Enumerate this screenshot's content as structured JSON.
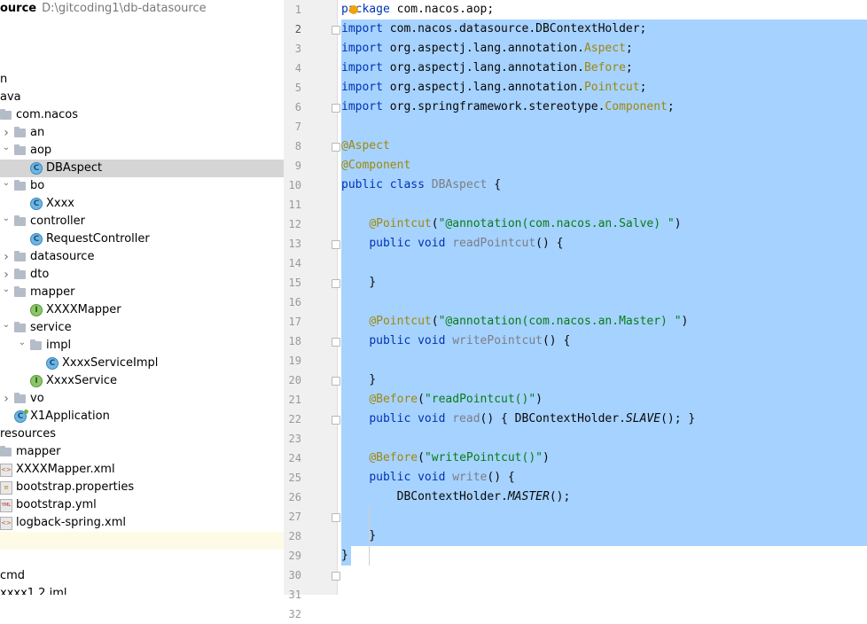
{
  "project": {
    "name": "ource",
    "path": "D:\\gitcoding1\\db-datasource"
  },
  "tree": {
    "items": [
      {
        "label": "n",
        "kind": "none",
        "depth": 0,
        "arrow": ""
      },
      {
        "label": "ava",
        "kind": "none",
        "depth": 0,
        "arrow": ""
      },
      {
        "label": "com.nacos",
        "kind": "folder",
        "depth": 1,
        "arrow": "open"
      },
      {
        "label": "an",
        "kind": "folder",
        "depth": 2,
        "arrow": "closed"
      },
      {
        "label": "aop",
        "kind": "folder",
        "depth": 2,
        "arrow": "open"
      },
      {
        "label": "DBAspect",
        "kind": "class",
        "depth": 3,
        "arrow": "",
        "selected": true
      },
      {
        "label": "bo",
        "kind": "folder",
        "depth": 2,
        "arrow": "open"
      },
      {
        "label": "Xxxx",
        "kind": "class",
        "depth": 3,
        "arrow": ""
      },
      {
        "label": "controller",
        "kind": "folder",
        "depth": 2,
        "arrow": "open"
      },
      {
        "label": "RequestController",
        "kind": "class",
        "depth": 3,
        "arrow": ""
      },
      {
        "label": "datasource",
        "kind": "folder",
        "depth": 2,
        "arrow": "closed"
      },
      {
        "label": "dto",
        "kind": "folder",
        "depth": 2,
        "arrow": "closed"
      },
      {
        "label": "mapper",
        "kind": "folder",
        "depth": 2,
        "arrow": "open"
      },
      {
        "label": "XXXXMapper",
        "kind": "interface",
        "depth": 3,
        "arrow": ""
      },
      {
        "label": "service",
        "kind": "folder",
        "depth": 2,
        "arrow": "open"
      },
      {
        "label": "impl",
        "kind": "folder",
        "depth": 3,
        "arrow": "open"
      },
      {
        "label": "XxxxServiceImpl",
        "kind": "class",
        "depth": 4,
        "arrow": ""
      },
      {
        "label": "XxxxService",
        "kind": "interface",
        "depth": 3,
        "arrow": ""
      },
      {
        "label": "vo",
        "kind": "folder",
        "depth": 2,
        "arrow": "closed"
      },
      {
        "label": "X1Application",
        "kind": "app",
        "depth": 2,
        "arrow": ""
      },
      {
        "label": "resources",
        "kind": "none",
        "depth": 0,
        "arrow": ""
      },
      {
        "label": "mapper",
        "kind": "folder",
        "depth": 0,
        "arrow": ""
      },
      {
        "label": "XXXXMapper.xml",
        "kind": "xml",
        "depth": 1,
        "arrow": ""
      },
      {
        "label": "bootstrap.properties",
        "kind": "props",
        "depth": 0,
        "arrow": ""
      },
      {
        "label": "bootstrap.yml",
        "kind": "yml",
        "depth": 0,
        "arrow": ""
      },
      {
        "label": "logback-spring.xml",
        "kind": "xml",
        "depth": 0,
        "arrow": ""
      },
      {
        "label": "",
        "kind": "none",
        "depth": 0,
        "arrow": "",
        "highlight": true
      },
      {
        "label": "",
        "kind": "none",
        "depth": 0,
        "arrow": ""
      },
      {
        "label": "cmd",
        "kind": "none",
        "depth": 0,
        "arrow": ""
      },
      {
        "label": "xxxx1.2.iml",
        "kind": "none",
        "depth": 0,
        "arrow": ""
      }
    ]
  },
  "editor": {
    "line_numbers": [
      "1",
      "2",
      "3",
      "4",
      "5",
      "6",
      "7",
      "8",
      "9",
      "10",
      "11",
      "12",
      "13",
      "14",
      "15",
      "16",
      "17",
      "18",
      "19",
      "20",
      "21",
      "22",
      "23",
      "24",
      "25",
      "26",
      "27",
      "28",
      "29",
      "30",
      "31",
      "32"
    ],
    "lines": [
      [
        {
          "t": "p",
          "c": "kw"
        },
        {
          "t": "ackage",
          "c": "kw"
        },
        {
          "t": " com.nacos.aop;",
          "c": ""
        }
      ],
      [
        {
          "t": "import",
          "c": "kw"
        },
        {
          "t": " com.nacos.datasource.DBContextHolder;",
          "c": ""
        }
      ],
      [
        {
          "t": "import",
          "c": "kw"
        },
        {
          "t": " org.aspectj.lang.annotation.",
          "c": ""
        },
        {
          "t": "Aspect",
          "c": "ann"
        },
        {
          "t": ";",
          "c": ""
        }
      ],
      [
        {
          "t": "import",
          "c": "kw"
        },
        {
          "t": " org.aspectj.lang.annotation.",
          "c": ""
        },
        {
          "t": "Before",
          "c": "ann"
        },
        {
          "t": ";",
          "c": ""
        }
      ],
      [
        {
          "t": "import",
          "c": "kw"
        },
        {
          "t": " org.aspectj.lang.annotation.",
          "c": ""
        },
        {
          "t": "Pointcut",
          "c": "ann"
        },
        {
          "t": ";",
          "c": ""
        }
      ],
      [
        {
          "t": "import",
          "c": "kw"
        },
        {
          "t": " org.springframework.stereotype.",
          "c": ""
        },
        {
          "t": "Component",
          "c": "ann"
        },
        {
          "t": ";",
          "c": ""
        }
      ],
      [],
      [
        {
          "t": "@Aspect",
          "c": "ann"
        }
      ],
      [
        {
          "t": "@Component",
          "c": "ann"
        }
      ],
      [
        {
          "t": "public class",
          "c": "kw"
        },
        {
          "t": " ",
          "c": ""
        },
        {
          "t": "DBAspect",
          "c": "mth"
        },
        {
          "t": " {",
          "c": ""
        }
      ],
      [],
      [
        {
          "t": "    ",
          "c": ""
        },
        {
          "t": "@Pointcut",
          "c": "ann"
        },
        {
          "t": "(",
          "c": ""
        },
        {
          "t": "\"@annotation(com.nacos.an.Salve) \"",
          "c": "str"
        },
        {
          "t": ")",
          "c": ""
        }
      ],
      [
        {
          "t": "    ",
          "c": ""
        },
        {
          "t": "public void",
          "c": "kw"
        },
        {
          "t": " ",
          "c": ""
        },
        {
          "t": "readPointcut",
          "c": "mth"
        },
        {
          "t": "() {",
          "c": ""
        }
      ],
      [],
      [
        {
          "t": "    }",
          "c": ""
        }
      ],
      [],
      [
        {
          "t": "    ",
          "c": ""
        },
        {
          "t": "@Pointcut",
          "c": "ann"
        },
        {
          "t": "(",
          "c": ""
        },
        {
          "t": "\"@annotation(com.nacos.an.Master) \"",
          "c": "str"
        },
        {
          "t": ")",
          "c": ""
        }
      ],
      [
        {
          "t": "    ",
          "c": ""
        },
        {
          "t": "public void",
          "c": "kw"
        },
        {
          "t": " ",
          "c": ""
        },
        {
          "t": "writePointcut",
          "c": "mth"
        },
        {
          "t": "() {",
          "c": ""
        }
      ],
      [],
      [
        {
          "t": "    }",
          "c": ""
        }
      ],
      [
        {
          "t": "    ",
          "c": ""
        },
        {
          "t": "@Before",
          "c": "ann"
        },
        {
          "t": "(",
          "c": ""
        },
        {
          "t": "\"readPointcut()\"",
          "c": "str"
        },
        {
          "t": ")",
          "c": ""
        }
      ],
      [
        {
          "t": "    ",
          "c": ""
        },
        {
          "t": "public void",
          "c": "kw"
        },
        {
          "t": " ",
          "c": ""
        },
        {
          "t": "read",
          "c": "mth"
        },
        {
          "t": "() { DBContextHolder.",
          "c": ""
        },
        {
          "t": "SLAVE",
          "c": "ital"
        },
        {
          "t": "(); }",
          "c": ""
        }
      ],
      [],
      [
        {
          "t": "    ",
          "c": ""
        },
        {
          "t": "@Before",
          "c": "ann"
        },
        {
          "t": "(",
          "c": ""
        },
        {
          "t": "\"writePointcut()\"",
          "c": "str"
        },
        {
          "t": ")",
          "c": ""
        }
      ],
      [
        {
          "t": "    ",
          "c": ""
        },
        {
          "t": "public void",
          "c": "kw"
        },
        {
          "t": " ",
          "c": ""
        },
        {
          "t": "write",
          "c": "mth"
        },
        {
          "t": "() {",
          "c": ""
        }
      ],
      [
        {
          "t": "        DBContextHolder.",
          "c": ""
        },
        {
          "t": "MASTER",
          "c": "ital"
        },
        {
          "t": "();",
          "c": ""
        }
      ],
      [],
      [
        {
          "t": "    }",
          "c": ""
        }
      ],
      [
        {
          "t": "}",
          "c": ""
        }
      ],
      []
    ],
    "fold_markers": [
      2,
      6,
      8,
      13,
      15,
      18,
      20,
      22,
      27,
      30
    ],
    "current_line": 2,
    "colors": {
      "selection": "#a6d2ff",
      "keyword": "#0033b3",
      "annotation": "#9e880d",
      "string": "#067d17"
    }
  }
}
